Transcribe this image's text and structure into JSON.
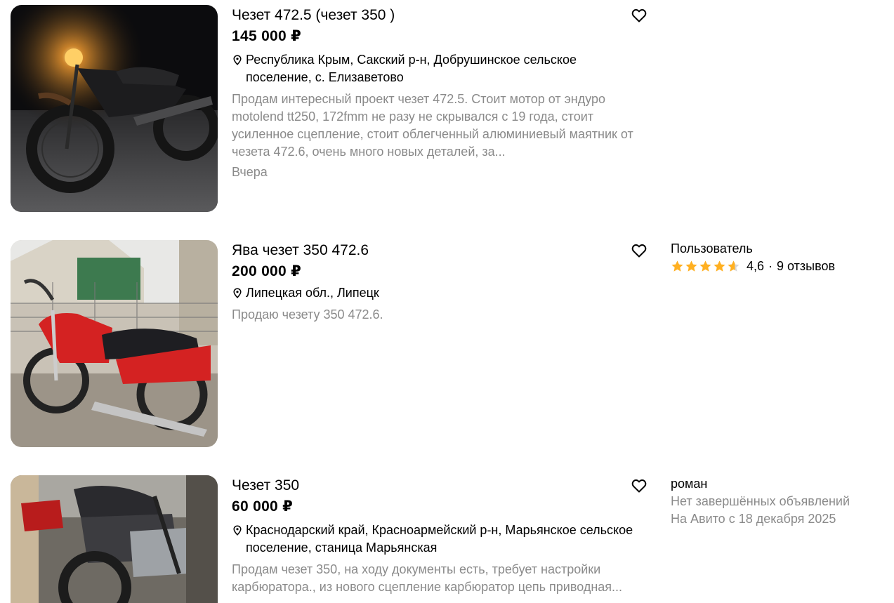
{
  "colors": {
    "text": "#000000",
    "muted": "#8a8a8a",
    "star": "#ffb021",
    "star_empty": "#d6d6d6"
  },
  "listings": [
    {
      "title": "Чезет 472.5 (чезет 350 )",
      "price": "145 000 ₽",
      "location": "Республика Крым, Сакский р-н, Добрушинское сельское поселение, с. Елизаветово",
      "description": "Продам интересный проект чезет 472.5. Стоит мотор от эндуро motolend tt250, 172fmm не разу не скрывался с 19 года, стоит усиленное сцепление, стоит облегченный алюминиевый маятник от чезета 472.6, очень много новых деталей, за...",
      "date": "Вчера",
      "favorite_icon": "heart-outline-icon"
    },
    {
      "title": "Ява чезет 350 472.6",
      "price": "200 000 ₽",
      "location": "Липецкая обл., Липецк",
      "description": "Продаю чезету 350 472.6.",
      "favorite_icon": "heart-outline-icon",
      "seller": {
        "name": "Пользователь",
        "rating": 4.6,
        "rating_text": "4,6",
        "separator": "·",
        "reviews": "9 отзывов"
      }
    },
    {
      "title": "Чезет 350",
      "price": "60 000 ₽",
      "location": "Краснодарский край, Красноармейский р-н, Марьянское сельское поселение, станица Марьянская",
      "description": "Продам чезет 350, на ходу документы есть, требует настройки карбюратора., из нового сцепление карбюратор цепь приводная...",
      "favorite_icon": "heart-outline-icon",
      "seller": {
        "name": "роман",
        "status": "Нет завершённых объявлений",
        "since": "На Авито с 18 декабря 2025"
      }
    }
  ]
}
